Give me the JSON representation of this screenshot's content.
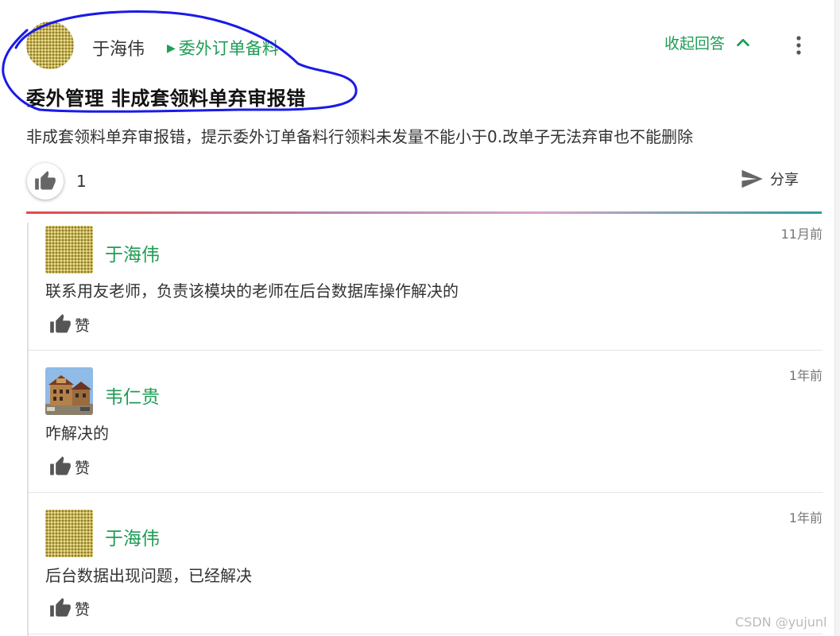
{
  "question": {
    "author": "于海伟",
    "topic": "委外订单备料",
    "collapse_label": "收起回答",
    "title": "委外管理 非成套领料单弃审报错",
    "body": "非成套领料单弃审报错，提示委外订单备料行领料未发量不能小于0.改单子无法弃审也不能删除",
    "like_count": "1",
    "share_label": "分享"
  },
  "replies": [
    {
      "author": "于海伟",
      "text": "联系用友老师，负责该模块的老师在后台数据库操作解决的",
      "time": "11月前",
      "like_label": "赞",
      "avatar": "pattern-avatar"
    },
    {
      "author": "韦仁贵",
      "text": "咋解决的",
      "time": "1年前",
      "like_label": "赞",
      "avatar": "building-photo-avatar"
    },
    {
      "author": "于海伟",
      "text": "后台数据出现问题，已经解决",
      "time": "1年前",
      "like_label": "赞",
      "avatar": "pattern-avatar"
    }
  ],
  "watermark": "CSDN @yujunl",
  "colors": {
    "accent": "#1f9d55",
    "annotation": "#1a1ae6"
  },
  "icons": {
    "like": "thumb-up-icon",
    "share": "send-icon",
    "more": "more-vert-icon",
    "collapse": "chevron-up-icon",
    "topic": "triangle-right-icon"
  }
}
